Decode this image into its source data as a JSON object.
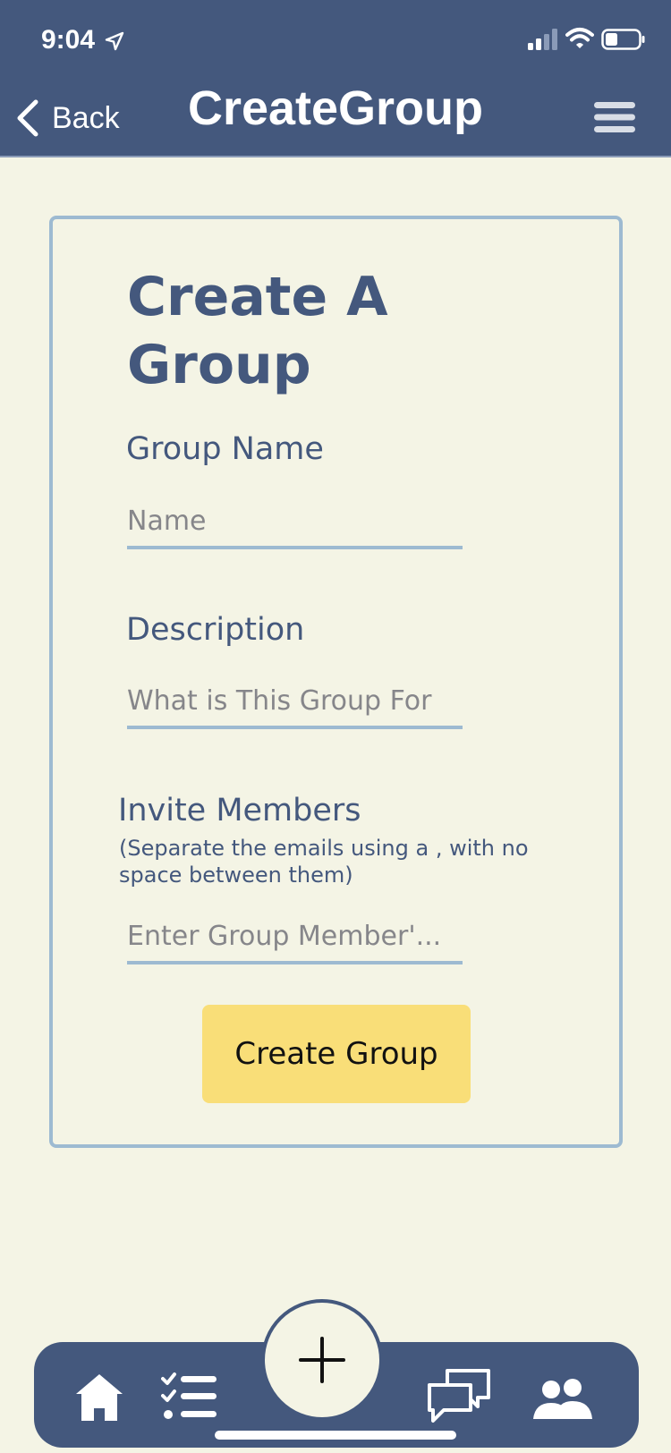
{
  "status_bar": {
    "time": "9:04"
  },
  "nav": {
    "back_label": "Back",
    "title": "CreateGroup"
  },
  "form": {
    "heading": "Create A Group",
    "group_name": {
      "label": "Group Name",
      "placeholder": "Name"
    },
    "description": {
      "label": "Description",
      "placeholder": "What is This Group For"
    },
    "invite_members": {
      "label": "Invite Members",
      "hint": "(Separate the emails using a , with no space between them)",
      "placeholder": "Enter Group Member'..."
    },
    "submit_label": "Create Group"
  },
  "tab_bar": {
    "items": [
      {
        "icon": "home-icon"
      },
      {
        "icon": "checklist-icon"
      },
      {
        "icon": "add-icon"
      },
      {
        "icon": "chat-icon"
      },
      {
        "icon": "people-icon"
      }
    ]
  },
  "colors": {
    "header": "#44587d",
    "background": "#f4f4e5",
    "accent_border": "#9dbad1",
    "button": "#f9de78"
  }
}
